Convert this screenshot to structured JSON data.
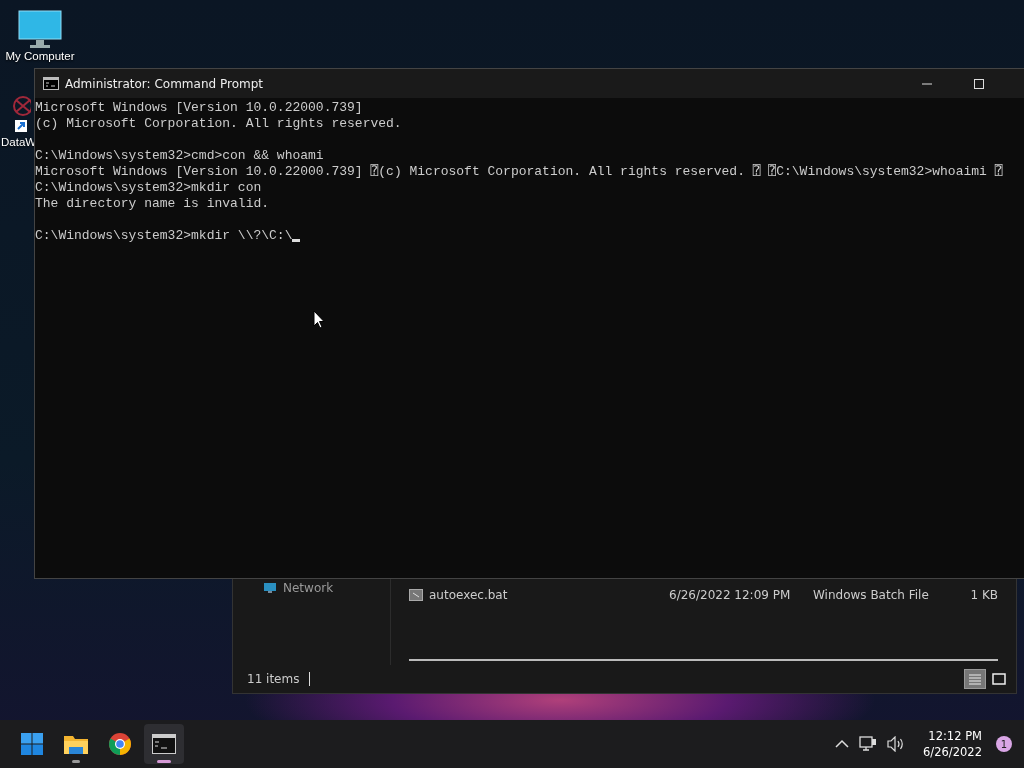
{
  "desktop_icons": [
    {
      "kind": "monitor",
      "label": "My Computer"
    },
    {
      "kind": "shortcut",
      "label": "DataW"
    }
  ],
  "explorer": {
    "nav_item": "Network",
    "files": [
      {
        "name": "autoexec.bat",
        "modified": "6/26/2022 12:09 PM",
        "type": "Windows Batch File",
        "size": "1 KB"
      }
    ],
    "status": "11 items",
    "views": [
      {
        "kind": "details",
        "selected": true
      },
      {
        "kind": "preview",
        "selected": false
      }
    ]
  },
  "console": {
    "title": "Administrator: Command Prompt",
    "blocks": [
      [
        "Microsoft Windows [Version 10.0.22000.739]",
        "(c) Microsoft Corporation. All rights reserved."
      ],
      [
        "C:\\Windows\\system32>cmd>con && whoami",
        "Microsoft Windows [Version 10.0.22000.739] ⍰(c) Microsoft Corporation. All rights reserved. ⍰ ⍰C:\\Windows\\system32>whoaimi ⍰",
        "C:\\Windows\\system32>mkdir con",
        "The directory name is invalid."
      ],
      [
        "C:\\Windows\\system32>mkdir \\\\?\\C:\\"
      ]
    ]
  },
  "taskbar": {
    "apps": [
      {
        "kind": "start",
        "running": false,
        "active": false
      },
      {
        "kind": "explorer",
        "running": true,
        "active": false
      },
      {
        "kind": "chrome",
        "running": false,
        "active": false
      },
      {
        "kind": "terminal",
        "running": true,
        "active": true
      }
    ],
    "time": "12:12 PM",
    "date": "6/26/2022",
    "notifications": "1"
  }
}
